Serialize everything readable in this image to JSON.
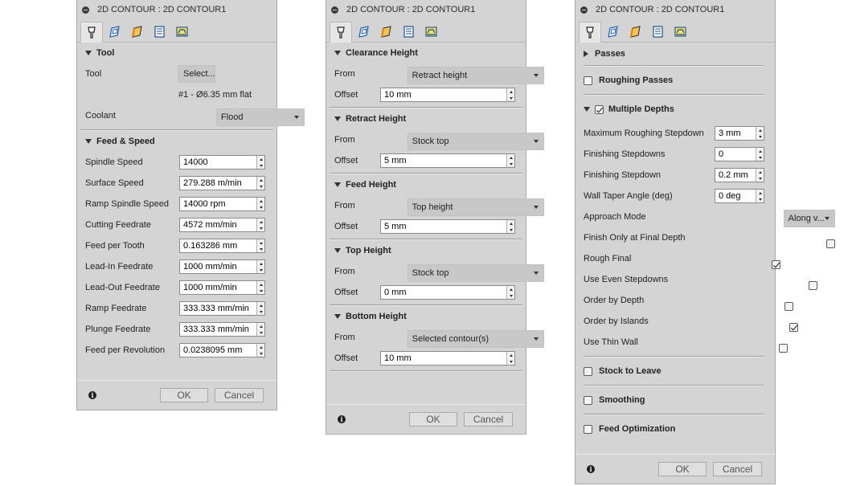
{
  "panel1": {
    "title": "2D CONTOUR : 2D CONTOUR1",
    "tool": {
      "heading": "Tool",
      "tool_label": "Tool",
      "select_label": "Select...",
      "tool_desc": "#1 - Ø6.35 mm flat",
      "coolant_label": "Coolant",
      "coolant_value": "Flood"
    },
    "feed": {
      "heading": "Feed & Speed",
      "rows": [
        {
          "label": "Spindle Speed",
          "value": "14000"
        },
        {
          "label": "Surface Speed",
          "value": "279.288 m/min"
        },
        {
          "label": "Ramp Spindle Speed",
          "value": "14000 rpm"
        },
        {
          "label": "Cutting Feedrate",
          "value": "4572 mm/min"
        },
        {
          "label": "Feed per Tooth",
          "value": "0.163286 mm"
        },
        {
          "label": "Lead-In Feedrate",
          "value": "1000 mm/min"
        },
        {
          "label": "Lead-Out Feedrate",
          "value": "1000 mm/min"
        },
        {
          "label": "Ramp Feedrate",
          "value": "333.333 mm/min"
        },
        {
          "label": "Plunge Feedrate",
          "value": "333.333 mm/min"
        },
        {
          "label": "Feed per Revolution",
          "value": "0.0238095 mm"
        }
      ]
    },
    "ok": "OK",
    "cancel": "Cancel"
  },
  "panel2": {
    "title": "2D CONTOUR : 2D CONTOUR1",
    "sections": [
      {
        "heading": "Clearance Height",
        "from_label": "From",
        "from_value": "Retract height",
        "offset_label": "Offset",
        "offset_value": "10 mm"
      },
      {
        "heading": "Retract Height",
        "from_label": "From",
        "from_value": "Stock top",
        "offset_label": "Offset",
        "offset_value": "5 mm"
      },
      {
        "heading": "Feed Height",
        "from_label": "From",
        "from_value": "Top height",
        "offset_label": "Offset",
        "offset_value": "5 mm"
      },
      {
        "heading": "Top Height",
        "from_label": "From",
        "from_value": "Stock top",
        "offset_label": "Offset",
        "offset_value": "0 mm"
      },
      {
        "heading": "Bottom Height",
        "from_label": "From",
        "from_value": "Selected contour(s)",
        "offset_label": "Offset",
        "offset_value": "10 mm"
      }
    ],
    "ok": "OK",
    "cancel": "Cancel"
  },
  "panel3": {
    "title": "2D CONTOUR : 2D CONTOUR1",
    "passes_heading": "Passes",
    "roughing_passes": "Roughing Passes",
    "multiple_depths": "Multiple Depths",
    "rows": {
      "max_stepdown": {
        "label": "Maximum Roughing Stepdown",
        "value": "3 mm"
      },
      "finishing_stepdowns": {
        "label": "Finishing Stepdowns",
        "value": "0"
      },
      "finishing_stepdown": {
        "label": "Finishing Stepdown",
        "value": "0.2 mm"
      },
      "wall_taper": {
        "label": "Wall Taper Angle (deg)",
        "value": "0 deg"
      },
      "approach_mode": {
        "label": "Approach Mode",
        "value": "Along v..."
      }
    },
    "checks": [
      {
        "label": "Finish Only at Final Depth",
        "checked": false
      },
      {
        "label": "Rough Final",
        "checked": true
      },
      {
        "label": "Use Even Stepdowns",
        "checked": false
      },
      {
        "label": "Order by Depth",
        "checked": false
      },
      {
        "label": "Order by Islands",
        "checked": true
      },
      {
        "label": "Use Thin Wall",
        "checked": false
      }
    ],
    "stock_to_leave": "Stock to Leave",
    "smoothing": "Smoothing",
    "feed_optimization": "Feed Optimization",
    "ok": "OK",
    "cancel": "Cancel"
  },
  "icons": [
    "tool-tab-icon",
    "geometry-tab-icon",
    "heights-tab-icon",
    "passes-tab-icon",
    "linking-tab-icon",
    "info-icon"
  ]
}
